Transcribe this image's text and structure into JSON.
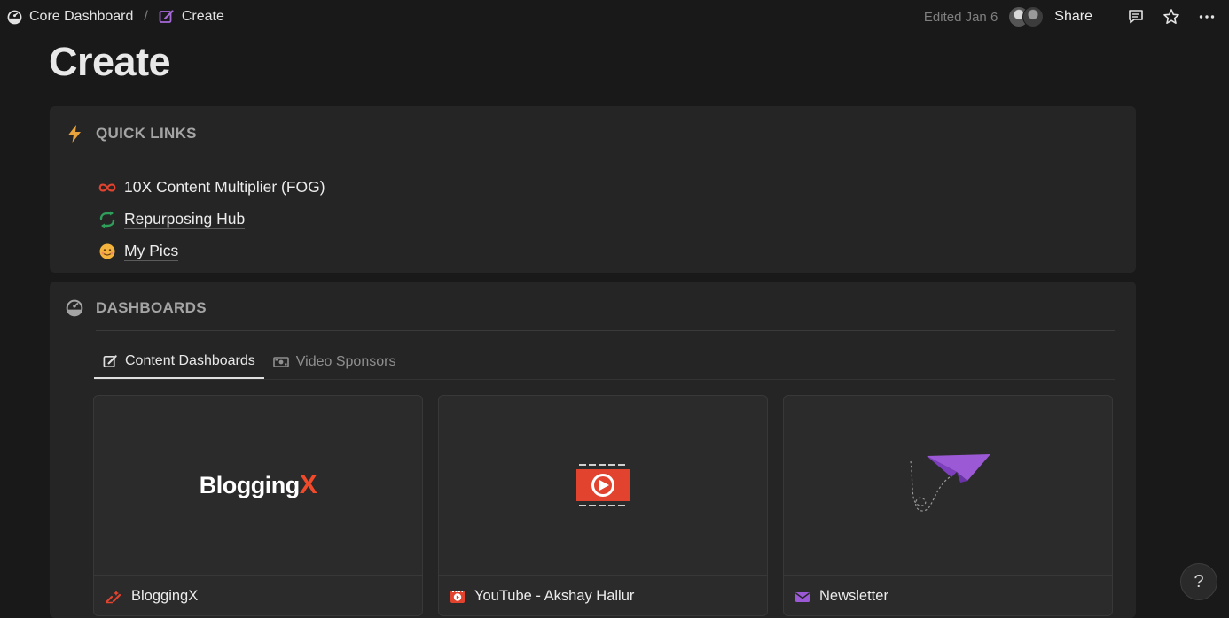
{
  "breadcrumb": {
    "parent": "Core Dashboard",
    "separator": "/",
    "current": "Create"
  },
  "topbar": {
    "edited": "Edited Jan 6",
    "share_label": "Share",
    "icons": [
      "comment-icon",
      "star-icon",
      "more-icon"
    ]
  },
  "page": {
    "title": "Create"
  },
  "quick_links": {
    "heading": "QUICK LINKS",
    "items": [
      {
        "label": "10X Content Multiplier (FOG)",
        "icon": "infinity-icon"
      },
      {
        "label": "Repurposing Hub",
        "icon": "repeat-icon"
      },
      {
        "label": "My Pics",
        "icon": "face-emoji-icon"
      }
    ]
  },
  "dashboards": {
    "heading": "DASHBOARDS",
    "tabs": [
      {
        "label": "Content Dashboards",
        "icon": "edit-icon",
        "active": true
      },
      {
        "label": "Video Sponsors",
        "icon": "money-icon",
        "active": false
      }
    ],
    "cards": [
      {
        "name": "BloggingX",
        "logo_text": "Blogging",
        "logo_accent": "X",
        "icon": "pen-sparkle-icon"
      },
      {
        "name": "YouTube - Akshay Hallur",
        "icon": "play-square-icon"
      },
      {
        "name": "Newsletter",
        "icon": "envelope-icon"
      }
    ]
  },
  "help": {
    "label": "?"
  },
  "colors": {
    "background": "#191919",
    "panel": "#252525",
    "card": "#2b2b2b",
    "accent_red": "#e2432f",
    "accent_purple": "#9b59d6",
    "accent_green": "#2f9e5a",
    "accent_orange": "#e8a33d"
  }
}
